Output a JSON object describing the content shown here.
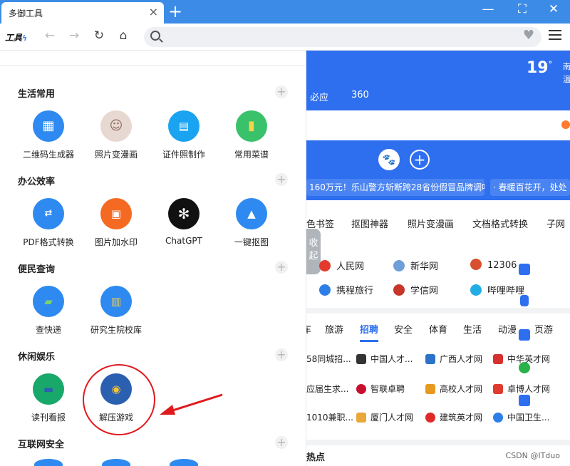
{
  "window": {
    "tab_title": "多御工具",
    "tab_close": "×",
    "new_tab": "+",
    "minimize": "—",
    "fullscreen": "⛶",
    "close": "✕"
  },
  "toolbar": {
    "logo": "工具",
    "back": "←",
    "forward": "→",
    "reload": "↻",
    "home": "⌂",
    "address_value": "",
    "favorite": "♥"
  },
  "panel": {
    "sections": [
      {
        "title": "生活常用",
        "add": "+",
        "tools": [
          {
            "label": "二维码生成器",
            "icon": "qr-code-icon",
            "color": "#2e8af0"
          },
          {
            "label": "照片变漫画",
            "icon": "portrait-photo-icon",
            "color": "#e8d8d2"
          },
          {
            "label": "证件照制作",
            "icon": "id-card-icon",
            "color": "#1aa3f0"
          },
          {
            "label": "常用菜谱",
            "icon": "recipe-book-icon",
            "color": "#39c26a"
          }
        ]
      },
      {
        "title": "办公效率",
        "add": "+",
        "tools": [
          {
            "label": "PDF格式转换",
            "icon": "pdf-convert-icon",
            "color": "#2e8af0"
          },
          {
            "label": "图片加水印",
            "icon": "image-watermark-icon",
            "color": "#f56a22"
          },
          {
            "label": "ChatGPT",
            "icon": "chatgpt-icon",
            "color": "#111111"
          },
          {
            "label": "一键抠图",
            "icon": "cutout-image-icon",
            "color": "#2e8af0"
          }
        ]
      },
      {
        "title": "便民查询",
        "add": "+",
        "tools": [
          {
            "label": "查快递",
            "icon": "delivery-truck-icon",
            "color": "#2e8af0"
          },
          {
            "label": "研究生院校库",
            "icon": "campus-building-icon",
            "color": "#2e8af0"
          }
        ]
      },
      {
        "title": "休闲娱乐",
        "add": "+",
        "tools": [
          {
            "label": "读刊看报",
            "icon": "magazine-icon",
            "color": "#17a86a"
          },
          {
            "label": "解压游戏",
            "icon": "monster-truck-game-icon",
            "color": "#2b5fb0"
          }
        ]
      },
      {
        "title": "互联网安全",
        "add": "+",
        "tools": []
      }
    ]
  },
  "page": {
    "temperature": "19",
    "degree": "°",
    "weather_side": "南温",
    "engines": [
      "必应",
      "360"
    ],
    "plus": "+",
    "news": [
      "160万元！乐山警方斩断跨28省份假冒品牌调味",
      "· 春暖百花开，处处"
    ],
    "quick_links": [
      "色书签",
      "抠图神器",
      "照片变漫画",
      "文档格式转换",
      "子网"
    ],
    "collapse": "收起",
    "sites_row1": [
      "人民网",
      "新华网",
      "12306"
    ],
    "sites_row2": [
      "携程旅行",
      "学信网",
      "哔哩哔哩"
    ],
    "categories": [
      "车",
      "旅游",
      "招聘",
      "安全",
      "体育",
      "生活",
      "动漫",
      "页游"
    ],
    "active_category": "招聘",
    "jobs_row1": [
      "58同城招...",
      "中国人才...",
      "广西人才网",
      "中华英才网"
    ],
    "jobs_row2": [
      "应届生求...",
      "智联卓聘",
      "高校人才网",
      "卓博人才网"
    ],
    "jobs_row3": [
      "1010兼职...",
      "厦门人才网",
      "建筑英才网",
      "中国卫生..."
    ],
    "hot_title": "热点",
    "watermark": "CSDN @ITduo"
  }
}
